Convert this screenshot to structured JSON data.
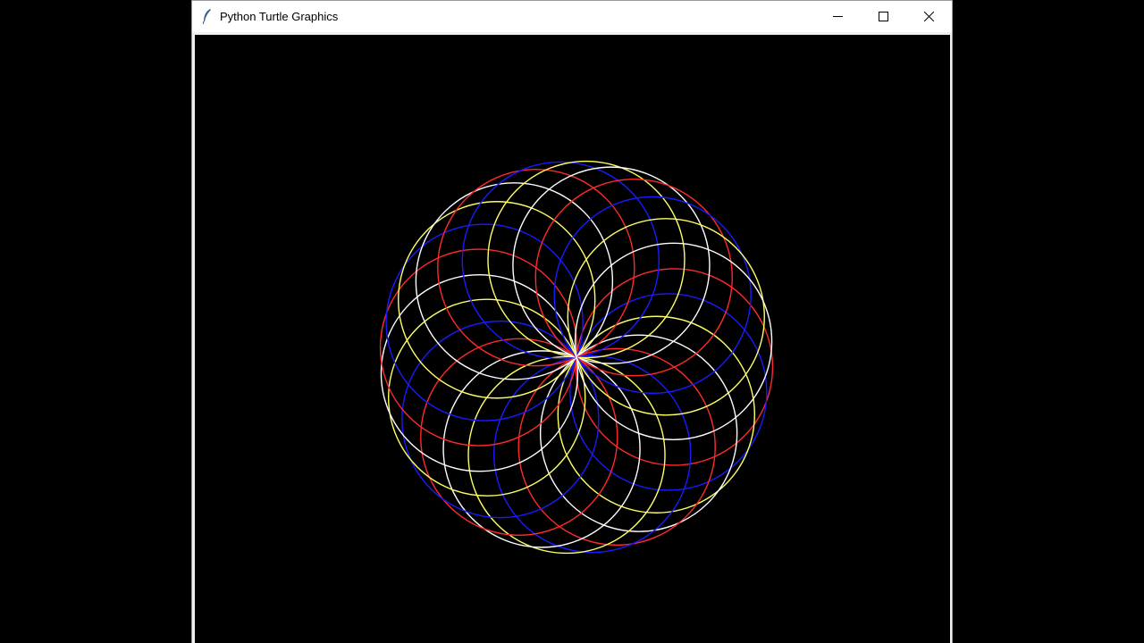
{
  "window": {
    "title": "Python Turtle Graphics",
    "icons": {
      "app": "feather-icon",
      "minimize": "minimize-icon",
      "maximize": "maximize-icon",
      "close": "close-icon"
    }
  },
  "canvas": {
    "background": "#000000",
    "drawing": {
      "description_kind": "spirograph",
      "colors": [
        "#ff2a2a",
        "#1a1aff",
        "#ffff66",
        "#ffffff"
      ],
      "circle_count": 24
    }
  }
}
